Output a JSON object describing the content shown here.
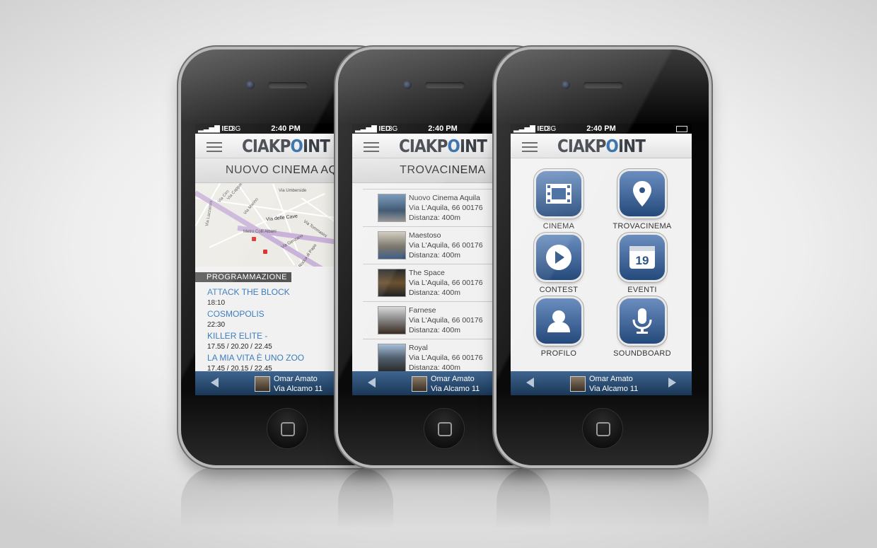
{
  "status": {
    "carrier": "IED",
    "network": "3G",
    "time": "2:40 PM"
  },
  "app": {
    "logo_prefix": "CIAKP",
    "logo_o": "O",
    "logo_suffix": "INT"
  },
  "user": {
    "name": "Omar Amato",
    "address": "Via Alcamo 11"
  },
  "screen1": {
    "title": "NUOVO CINEMA AQUILA",
    "map_street": "Via delle Cave",
    "map_labels": [
      "Via Umberside",
      "Via Capparelli",
      "Via Tommasini",
      "Metro Colli Albani",
      "Via Genzano",
      "Via Marino",
      "Via Lazzaroni",
      "Rocca di Papa",
      "Via Ciro"
    ],
    "section": "PROGRAMMAZIONE",
    "shows": [
      {
        "title": "ATTACK THE BLOCK",
        "times": "18:10"
      },
      {
        "title": "COSMOPOLIS",
        "times": "22:30"
      },
      {
        "title": "KILLER ELITE -",
        "times": "17.55 / 20.20 / 22.45"
      },
      {
        "title": "LA MIA VITA È UNO ZOO",
        "times": "17.45 / 20.15 / 22.45"
      }
    ]
  },
  "screen2": {
    "title": "TROVACINEMA",
    "cinemas": [
      {
        "name": "Nuovo Cinema Aquila",
        "address": "Via L'Aquila, 66 00176",
        "distance": "Distanza: 400m"
      },
      {
        "name": "Maestoso",
        "address": "Via L'Aquila, 66 00176",
        "distance": "Distanza: 400m"
      },
      {
        "name": "The Space",
        "address": "Via L'Aquila, 66 00176",
        "distance": "Distanza: 400m"
      },
      {
        "name": "Farnese",
        "address": "Via L'Aquila, 66 00176",
        "distance": "Distanza: 400m"
      },
      {
        "name": "Royal",
        "address": "Via L'Aquila, 66 00176",
        "distance": "Distanza: 400m"
      }
    ]
  },
  "screen3": {
    "menu": [
      {
        "label": "CINEMA",
        "icon": "film-icon"
      },
      {
        "label": "TROVACINEMA",
        "icon": "map-pin-icon"
      },
      {
        "label": "CONTEST",
        "icon": "play-icon"
      },
      {
        "label": "EVENTI",
        "icon": "calendar-icon",
        "badge": "19"
      },
      {
        "label": "PROFILO",
        "icon": "user-icon"
      },
      {
        "label": "SOUNDBOARD",
        "icon": "microphone-icon"
      }
    ]
  }
}
